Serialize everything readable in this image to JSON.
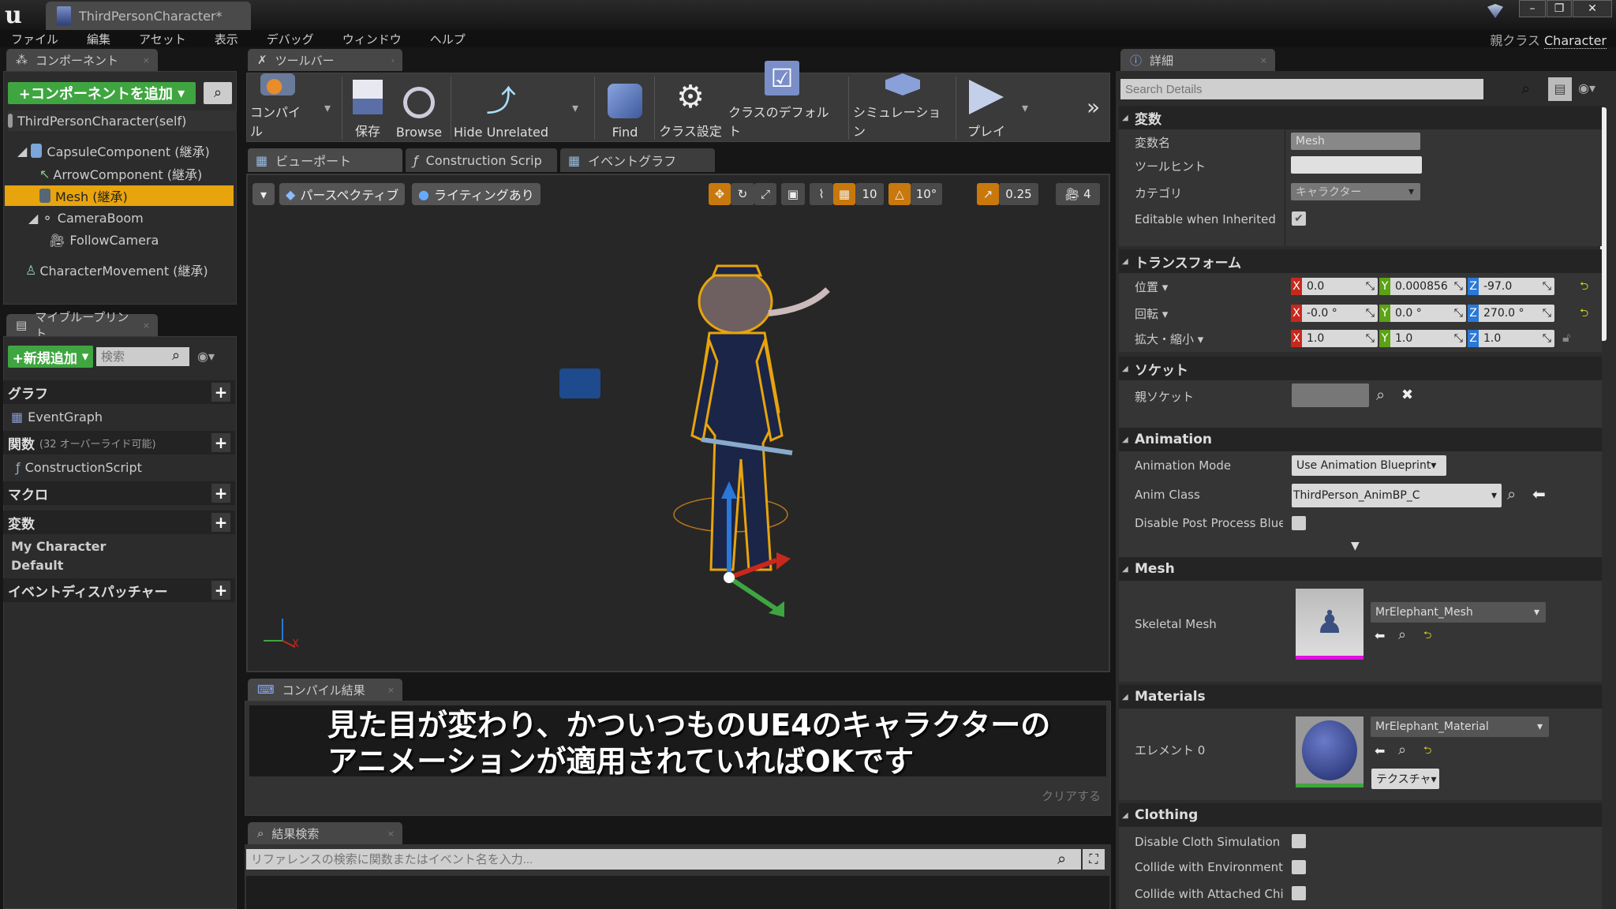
{
  "window": {
    "doc_tab": "ThirdPersonCharacter*",
    "parent_class_label": "親クラス",
    "parent_class": "Character",
    "minimize": "–",
    "restore": "❐",
    "close": "✕"
  },
  "menu": [
    "ファイル",
    "編集",
    "アセット",
    "表示",
    "デバッグ",
    "ウィンドウ",
    "ヘルプ"
  ],
  "components": {
    "tab": "コンポーネント",
    "add_button": "+コンポーネントを追加",
    "items": [
      {
        "label": "ThirdPersonCharacter(self)"
      },
      {
        "label": "CapsuleComponent (継承)"
      },
      {
        "label": "ArrowComponent (継承)"
      },
      {
        "label": "Mesh (継承)"
      },
      {
        "label": "CameraBoom"
      },
      {
        "label": "FollowCamera"
      },
      {
        "label": "CharacterMovement (継承)"
      }
    ]
  },
  "my_blueprint": {
    "tab": "マイブループリント",
    "add_new": "+新規追加",
    "search_placeholder": "検索",
    "graphs": "グラフ",
    "event_graph": "EventGraph",
    "functions": "関数",
    "functions_note": "(32 オーバーライド可能)",
    "construction_script": "ConstructionScript",
    "macros": "マクロ",
    "variables": "変数",
    "var_groups": [
      "My Character",
      "Default"
    ],
    "dispatchers": "イベントディスパッチャー"
  },
  "toolbar": {
    "tab": "ツールバー",
    "buttons": [
      "コンパイル",
      "保存",
      "Browse",
      "Hide Unrelated",
      "Find",
      "クラス設定",
      "クラスのデフォルト",
      "シミュレーション",
      "プレイ"
    ],
    "more": "»"
  },
  "editor_tabs": [
    "ビューポート",
    "Construction Scrip",
    "イベントグラフ"
  ],
  "viewport": {
    "perspective": "パースペクティブ",
    "lighting": "ライティングあり",
    "grid_snap": "10",
    "rot_snap": "10°",
    "scale_snap": "0.25",
    "cam_speed": "4"
  },
  "compile": {
    "tab": "コンパイル結果",
    "clear": "クリアする",
    "subtitle_line1": "見た目が変わり、かついつものUE4のキャラクターの",
    "subtitle_line2": "アニメーションが適用されていればOKです"
  },
  "find": {
    "tab": "結果検索",
    "placeholder": "リファレンスの検索に関数またはイベント名を入力..."
  },
  "details": {
    "tab": "詳細",
    "search_placeholder": "Search Details",
    "variable": {
      "header": "変数",
      "name_label": "変数名",
      "name": "Mesh",
      "tooltip_label": "ツールヒント",
      "tooltip": "",
      "category_label": "カテゴリ",
      "category": "キャラクター",
      "editable_label": "Editable when Inherited",
      "editable": true
    },
    "transform": {
      "header": "トランスフォーム",
      "location_label": "位置 ▾",
      "rotation_label": "回転 ▾",
      "scale_label": "拡大・縮小 ▾",
      "location": [
        "0.0",
        "0.000856",
        "-97.0"
      ],
      "rotation": [
        "-0.0 °",
        "0.0 °",
        "270.0 °"
      ],
      "scale": [
        "1.0",
        "1.0",
        "1.0"
      ],
      "axes": [
        "X",
        "Y",
        "Z"
      ]
    },
    "sockets": {
      "header": "ソケット",
      "parent_socket_label": "親ソケット"
    },
    "animation": {
      "header": "Animation",
      "mode_label": "Animation Mode",
      "mode": "Use Animation Blueprint",
      "class_label": "Anim Class",
      "class": "ThirdPerson_AnimBP_C",
      "disable_pp_label": "Disable Post Process Bluep"
    },
    "mesh": {
      "header": "Mesh",
      "skeletal_label": "Skeletal Mesh",
      "skeletal": "MrElephant_Mesh"
    },
    "materials": {
      "header": "Materials",
      "element_label": "エレメント 0",
      "material": "MrElephant_Material",
      "texture_btn": "テクスチャ▾"
    },
    "clothing": {
      "header": "Clothing",
      "rows": [
        "Disable Cloth Simulation",
        "Collide with Environment",
        "Collide with Attached Childi"
      ]
    }
  },
  "colors": {
    "accent": "#e8a40c",
    "green": "#3fa540",
    "x": "#c8281c",
    "y": "#5ca214",
    "z": "#2a78d8"
  }
}
